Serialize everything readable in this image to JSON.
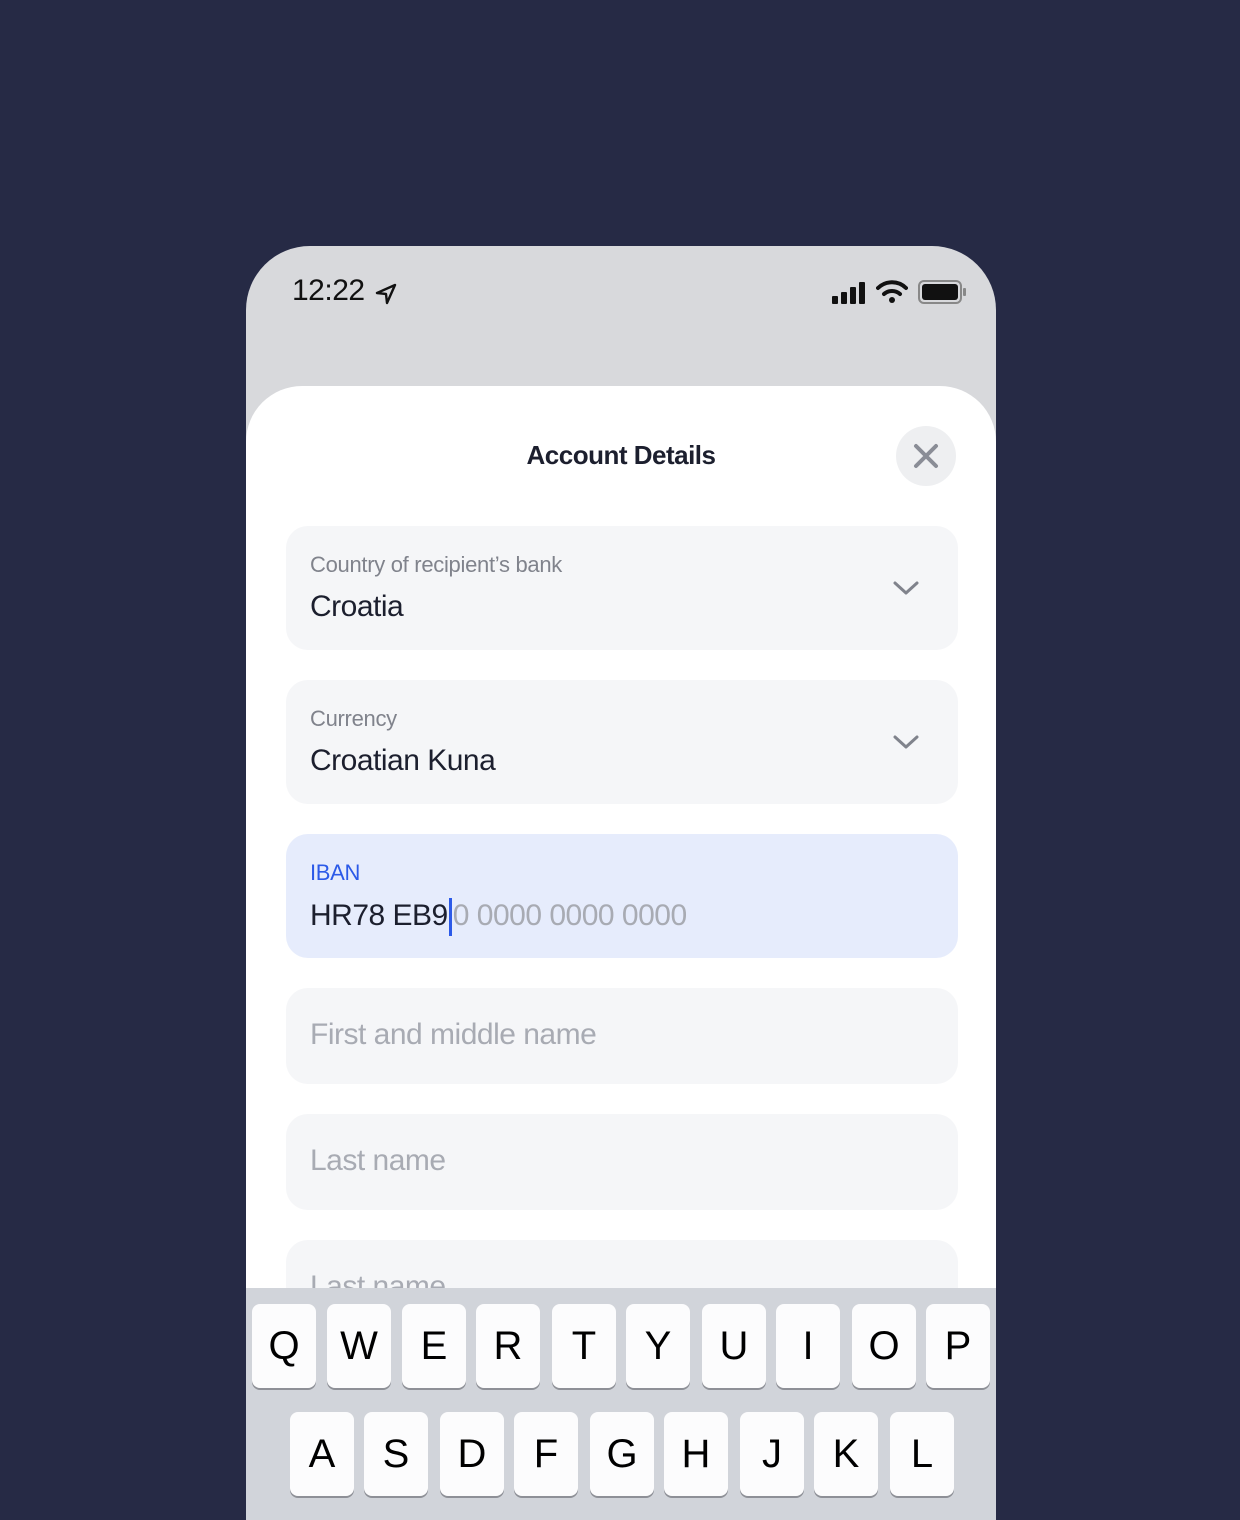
{
  "status_bar": {
    "time": "12:22"
  },
  "sheet": {
    "title": "Account Details",
    "close_icon": "close-icon",
    "fields": [
      {
        "label": "Country of recipient’s bank",
        "value": "Croatia",
        "type": "dropdown"
      },
      {
        "label": "Currency",
        "value": "Croatian Kuna",
        "type": "dropdown"
      },
      {
        "label": "IBAN",
        "value": "HR78 EB9",
        "placeholder_remainder": "0 0000 0000 0000",
        "focused": true
      },
      {
        "placeholder": "First and middle name"
      },
      {
        "placeholder": "Last name"
      },
      {
        "placeholder": "Last name"
      }
    ]
  },
  "colors": {
    "accent": "#2c5ae8",
    "background": "#262a45"
  },
  "keyboard": {
    "row1": [
      "Q",
      "W",
      "E",
      "R",
      "T",
      "Y",
      "U",
      "I",
      "O",
      "P"
    ],
    "row2": [
      "A",
      "S",
      "D",
      "F",
      "G",
      "H",
      "J",
      "K",
      "L"
    ]
  }
}
